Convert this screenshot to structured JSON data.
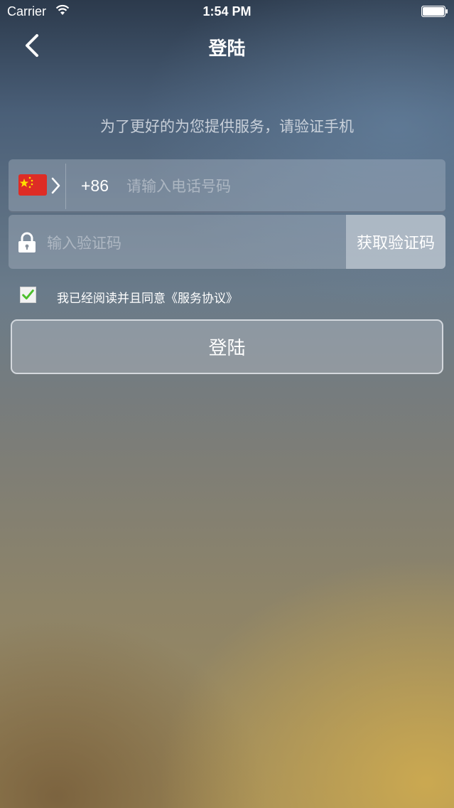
{
  "status_bar": {
    "carrier": "Carrier",
    "time": "1:54 PM",
    "wifi_icon": "wifi-icon",
    "battery_icon": "battery-icon"
  },
  "nav": {
    "back_icon": "chevron-left-icon",
    "title": "登陆"
  },
  "subtitle": "为了更好的为您提供服务，请验证手机",
  "phone": {
    "flag_icon": "china-flag-icon",
    "country_code": "+86",
    "placeholder": "请输入电话号码",
    "value": ""
  },
  "verification": {
    "lock_icon": "lock-icon",
    "placeholder": "输入验证码",
    "value": "",
    "get_code_label": "获取验证码"
  },
  "agreement": {
    "checked": true,
    "text": "我已经阅读并且同意《服务协议》",
    "checkmark_color": "#4cbf2c"
  },
  "login_button_label": "登陆",
  "colors": {
    "accent_red": "#de2c25",
    "flag_star": "#ffde00"
  }
}
